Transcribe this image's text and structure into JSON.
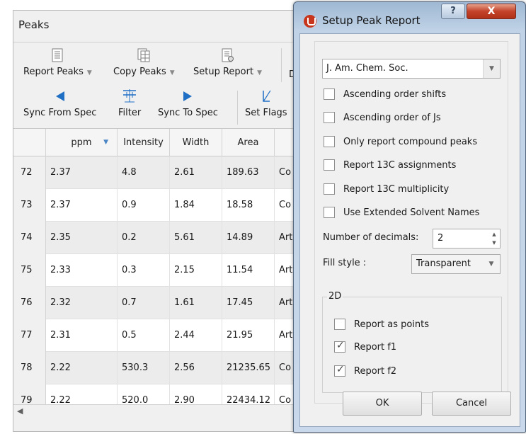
{
  "peaks": {
    "title": "Peaks",
    "toolbar": {
      "report_peaks": "Report Peaks",
      "copy_peaks": "Copy Peaks",
      "setup_report": "Setup Report",
      "d_label": "D",
      "sync_from_spec": "Sync From Spec",
      "filter": "Filter",
      "sync_to_spec": "Sync To Spec",
      "set_flags": "Set Flags"
    },
    "columns": [
      "ppm",
      "Intensity",
      "Width",
      "Area"
    ],
    "rows": [
      {
        "idx": "72",
        "ppm": "2.37",
        "intensity": "4.8",
        "width": "2.61",
        "area": "189.63",
        "extra": "Co"
      },
      {
        "idx": "73",
        "ppm": "2.37",
        "intensity": "0.9",
        "width": "1.84",
        "area": "18.58",
        "extra": "Co"
      },
      {
        "idx": "74",
        "ppm": "2.35",
        "intensity": "0.2",
        "width": "5.61",
        "area": "14.89",
        "extra": "Art"
      },
      {
        "idx": "75",
        "ppm": "2.33",
        "intensity": "0.3",
        "width": "2.15",
        "area": "11.54",
        "extra": "Art"
      },
      {
        "idx": "76",
        "ppm": "2.32",
        "intensity": "0.7",
        "width": "1.61",
        "area": "17.45",
        "extra": "Art"
      },
      {
        "idx": "77",
        "ppm": "2.31",
        "intensity": "0.5",
        "width": "2.44",
        "area": "21.95",
        "extra": "Art"
      },
      {
        "idx": "78",
        "ppm": "2.22",
        "intensity": "530.3",
        "width": "2.56",
        "area": "21235.65",
        "extra": "Co"
      },
      {
        "idx": "79",
        "ppm": "2.22",
        "intensity": "520.0",
        "width": "2.90",
        "area": "22434.12",
        "extra": "Co"
      }
    ]
  },
  "dialog": {
    "title": "Setup Peak Report",
    "help_glyph": "?",
    "close_glyph": "X",
    "journal": "J. Am. Chem. Soc.",
    "options": [
      {
        "label": "Ascending order shifts",
        "checked": false
      },
      {
        "label": "Ascending order of Js",
        "checked": false
      },
      {
        "label": "Only report compound peaks",
        "checked": false
      },
      {
        "label": "Report 13C assignments",
        "checked": false
      },
      {
        "label": "Report 13C multiplicity",
        "checked": false
      },
      {
        "label": "Use Extended Solvent Names",
        "checked": false
      }
    ],
    "decimals_label": "Number of decimals:",
    "decimals_value": "2",
    "fill_style_label": "Fill style :",
    "fill_style_value": "Transparent",
    "group_2d_label": "2D",
    "options_2d": [
      {
        "label": "Report as points",
        "checked": false
      },
      {
        "label": "Report f1",
        "checked": true
      },
      {
        "label": "Report f2",
        "checked": true
      }
    ],
    "ok_label": "OK",
    "cancel_label": "Cancel"
  },
  "colors": {
    "accent_blue": "#1f6fc5",
    "app_icon_red": "#c7351c",
    "close_red": "#c4422a"
  },
  "icons": {
    "report_peaks": "report-list-icon",
    "copy_peaks": "copy-table-icon",
    "setup_report": "setup-report-icon",
    "sync_from_spec": "left-triangle-icon",
    "filter": "filter-peaks-icon",
    "sync_to_spec": "right-triangle-icon",
    "set_flags": "set-flags-icon"
  }
}
